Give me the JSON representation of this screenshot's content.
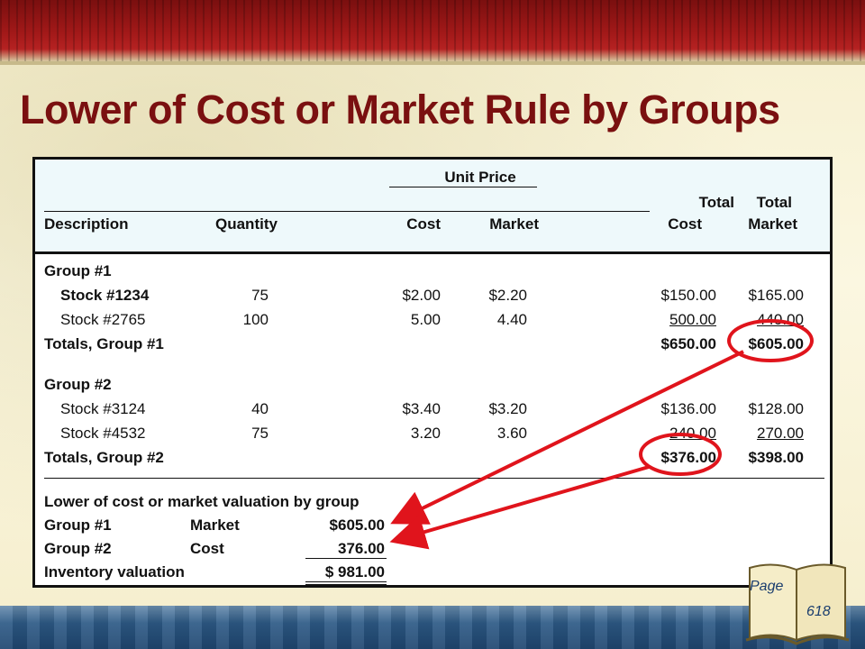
{
  "title": "Lower of Cost or Market Rule by Groups",
  "header": {
    "unit_price": "Unit Price",
    "total_1": "Total",
    "total_2": "Total",
    "description": "Description",
    "quantity": "Quantity",
    "cost": "Cost",
    "market": "Market",
    "total_cost": "Cost",
    "total_market": "Market"
  },
  "group1": {
    "label": "Group #1",
    "rows": [
      {
        "desc": "Stock #1234",
        "qty": "75",
        "cost": "$2.00",
        "market": "$2.20",
        "total_cost": "$150.00",
        "total_market": "$165.00"
      },
      {
        "desc": "Stock #2765",
        "qty": "100",
        "cost": "5.00",
        "market": "4.40",
        "total_cost": "500.00",
        "total_market": "440.00"
      }
    ],
    "totals_label": "Totals, Group #1",
    "total_cost": "$650.00",
    "total_market": "$605.00"
  },
  "group2": {
    "label": "Group #2",
    "rows": [
      {
        "desc": "Stock #3124",
        "qty": "40",
        "cost": "$3.40",
        "market": "$3.20",
        "total_cost": "$136.00",
        "total_market": "$128.00"
      },
      {
        "desc": "Stock #4532",
        "qty": "75",
        "cost": "3.20",
        "market": "3.60",
        "total_cost": "240.00",
        "total_market": "270.00"
      }
    ],
    "totals_label": "Totals, Group #2",
    "total_cost": "$376.00",
    "total_market": "$398.00"
  },
  "valuation": {
    "heading": "Lower of cost or market valuation by group",
    "rows": [
      {
        "group": "Group #1",
        "basis": "Market",
        "amount": "$605.00"
      },
      {
        "group": "Group #2",
        "basis": "Cost",
        "amount": "376.00"
      }
    ],
    "total_label": "Inventory valuation",
    "total_amount": "$ 981.00"
  },
  "page_ref": {
    "label": "Page",
    "number": "618"
  },
  "colors": {
    "title": "#7a1010",
    "highlight": "#e0141c",
    "header_bg": "#eef9fb"
  }
}
